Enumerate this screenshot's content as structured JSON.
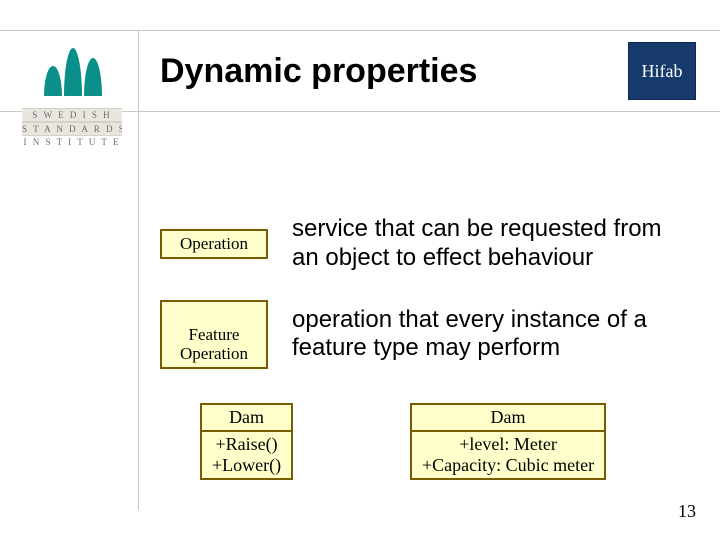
{
  "title": "Dynamic properties",
  "logos": {
    "ssi": {
      "line1": "S W E D I S H",
      "line2": "S T A N D A R D S",
      "line3": "I N S T I T U T E"
    },
    "hifab": "Hifab"
  },
  "definitions": [
    {
      "term": "Operation",
      "text": "service that can be requested from an object to effect behaviour"
    },
    {
      "term": "Feature\nOperation",
      "text": "operation that every instance of a feature type may perform"
    }
  ],
  "classes": [
    {
      "name": "Dam",
      "members": [
        "+Raise()",
        "+Lower()"
      ]
    },
    {
      "name": "Dam",
      "members": [
        "+level: Meter",
        "+Capacity: Cubic meter"
      ]
    }
  ],
  "page_number": "13"
}
